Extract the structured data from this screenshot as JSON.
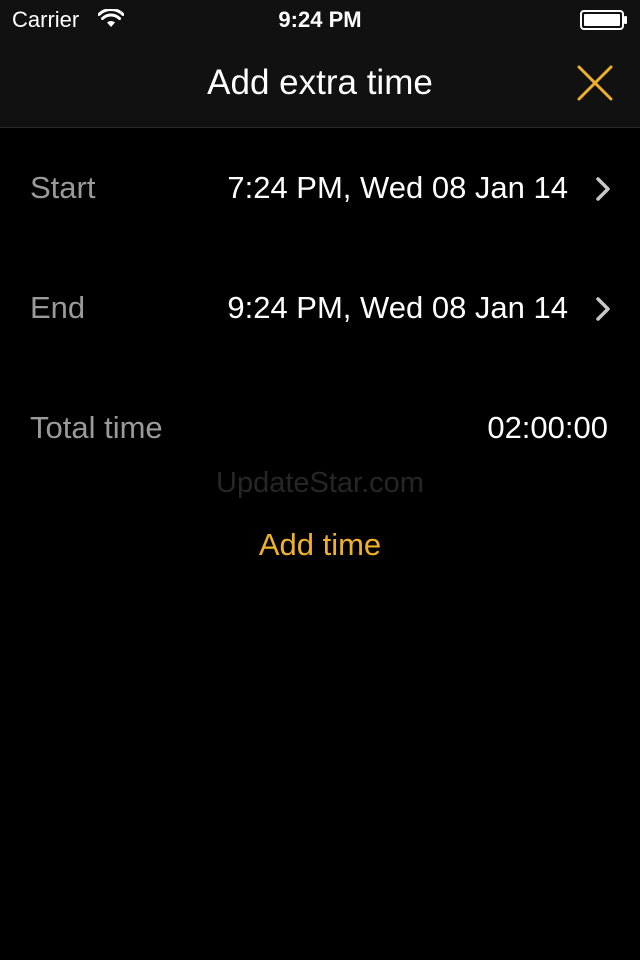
{
  "status_bar": {
    "carrier": "Carrier",
    "time": "9:24 PM",
    "wifi_icon": "wifi-icon",
    "battery_icon": "battery-full-icon"
  },
  "nav": {
    "title": "Add extra time",
    "close_icon": "close-x-icon"
  },
  "rows": {
    "start": {
      "label": "Start",
      "value": "7:24 PM, Wed 08 Jan 14"
    },
    "end": {
      "label": "End",
      "value": "9:24 PM, Wed 08 Jan 14"
    },
    "total": {
      "label": "Total time",
      "value": "02:00:00"
    }
  },
  "watermark": "UpdateStar.com",
  "actions": {
    "add_time_label": "Add time"
  },
  "colors": {
    "accent": "#f0b12a",
    "background": "#000000",
    "bar_background": "#111111",
    "label_gray": "#9a9a9a"
  }
}
